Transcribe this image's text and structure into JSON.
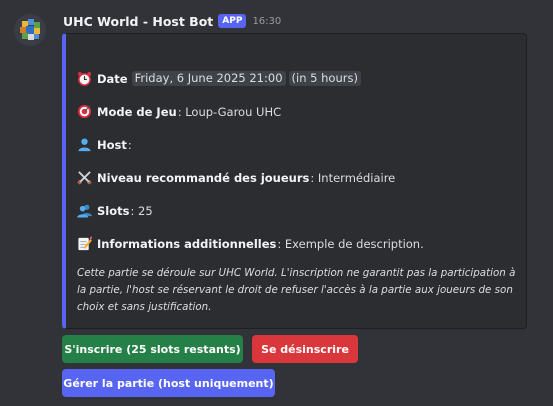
{
  "message": {
    "author": "UHC World - Host Bot",
    "badge": "APP",
    "time": "16:30"
  },
  "embed": {
    "accent_color": "#5865f2",
    "fields": {
      "date": {
        "icon": "alarm-clock-icon",
        "label": "Date",
        "value": "Friday, 6 June 2025 21:00",
        "relative": "(in 5 hours)"
      },
      "mode": {
        "icon": "target-icon",
        "label": "Mode de Jeu",
        "value": ": Loup-Garou UHC"
      },
      "host": {
        "icon": "user-silhouette-icon",
        "label": "Host",
        "value": ":"
      },
      "level": {
        "icon": "crossed-swords-icon",
        "label": "Niveau recommandé des joueurs",
        "value": ": Intermédiaire"
      },
      "slots": {
        "icon": "users-silhouette-icon",
        "label": "Slots",
        "value": ": 25"
      },
      "info": {
        "icon": "memo-icon",
        "label": "Informations additionnelles",
        "value": ": Exemple de description."
      }
    },
    "description": "Cette partie se déroule sur UHC World. L'inscription ne garantit pas la participation à la partie, l'host se réservant le droit de refuser l'accès à la partie aux joueurs de son choix et sans justification."
  },
  "buttons": {
    "join": {
      "label": "S'inscrire (25 slots restants)",
      "color": "#248046"
    },
    "leave": {
      "label": "Se désinscrire",
      "color": "#da373c"
    },
    "manage": {
      "label": "Gérer la partie (host uniquement)",
      "color": "#5865f2"
    }
  }
}
